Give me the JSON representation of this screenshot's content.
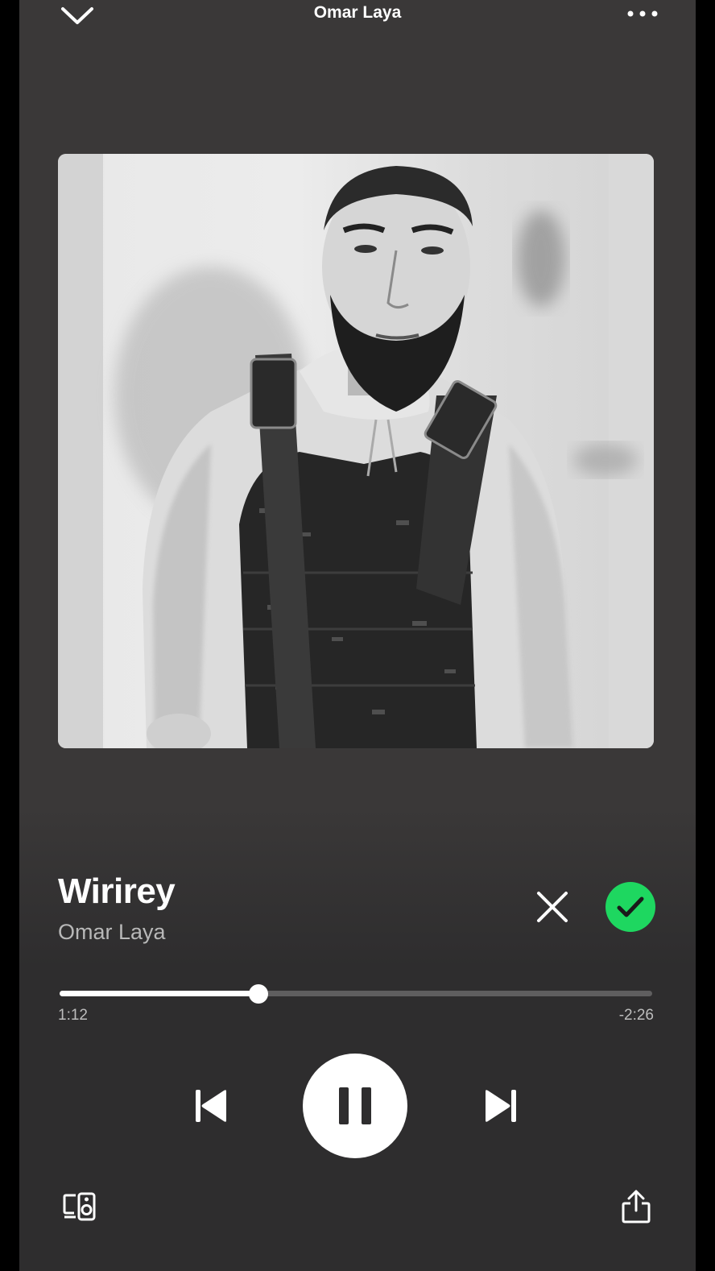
{
  "header": {
    "title": "Omar Laya",
    "collapse_icon": "chevron-down-icon",
    "more_icon": "more-horizontal-icon"
  },
  "artwork": {
    "description_icon": "album-artwork"
  },
  "track": {
    "title": "Wirirey",
    "artist": "Omar Laya"
  },
  "actions": {
    "close_icon": "close-icon",
    "liked_icon": "check-icon",
    "liked_color": "#1ed760"
  },
  "progress": {
    "elapsed": "1:12",
    "remaining": "-2:26",
    "fraction": 0.335
  },
  "controls": {
    "previous_icon": "skip-previous-icon",
    "play_pause_icon": "pause-icon",
    "next_icon": "skip-next-icon"
  },
  "footer": {
    "devices_icon": "connect-devices-icon",
    "share_icon": "share-icon"
  },
  "colors": {
    "background": "#3a3838",
    "accent": "#1ed760",
    "text_primary": "#ffffff",
    "text_secondary": "#b8b8b8"
  }
}
